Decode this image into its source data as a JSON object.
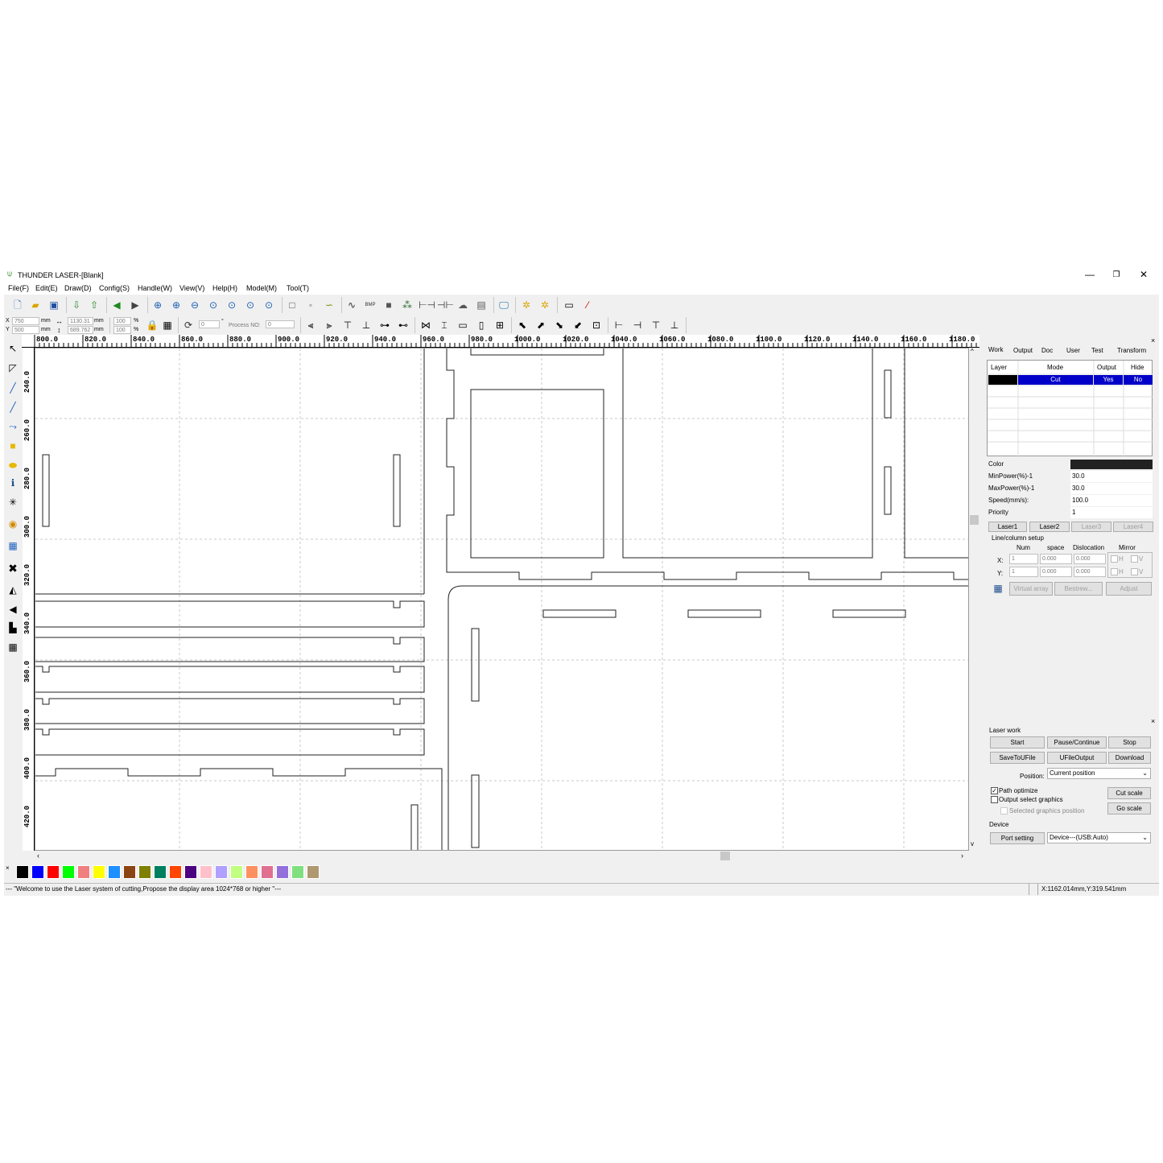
{
  "app": {
    "title": "THUNDER LASER-[Blank]"
  },
  "menu": [
    "File(F)",
    "Edit(E)",
    "Draw(D)",
    "Config(S)",
    "Handle(W)",
    "View(V)",
    "Help(H)",
    "Model(M)",
    "Tool(T)"
  ],
  "geometry": {
    "x_label": "X",
    "x_value": "750",
    "x_unit": "mm",
    "y_label": "Y",
    "y_value": "500",
    "y_unit": "mm",
    "w_value": "1130.31",
    "w_unit": "mm",
    "h_value": "689.762",
    "h_unit": "mm",
    "sx_value": "100",
    "sx_unit": "%",
    "sy_value": "100",
    "sy_unit": "%",
    "angle_value": "0",
    "angle_unit": "°",
    "process_label": "Process NO:",
    "process_value": "0"
  },
  "ruler": {
    "top": [
      "800.0",
      "820.0",
      "840.0",
      "860.0",
      "880.0",
      "900.0",
      "920.0",
      "940.0",
      "960.0",
      "980.0",
      "1000.0",
      "1020.0",
      "1040.0",
      "1060.0",
      "1080.0",
      "1100.0",
      "1120.0",
      "1140.0",
      "1160.0",
      "1180.0"
    ],
    "left": [
      "240.0",
      "260.0",
      "280.0",
      "300.0",
      "320.0",
      "340.0",
      "360.0",
      "380.0",
      "400.0",
      "420.0"
    ]
  },
  "panel": {
    "tabs": [
      "Work",
      "Output",
      "Doc",
      "User",
      "Test",
      "Transform"
    ],
    "layer_headers": [
      "Layer",
      "Mode",
      "Output",
      "Hide"
    ],
    "layer_row": {
      "mode": "Cut",
      "output": "Yes",
      "hide": "No"
    },
    "props": [
      {
        "k": "Color",
        "v": ""
      },
      {
        "k": "MinPower(%)-1",
        "v": "30.0"
      },
      {
        "k": "MaxPower(%)-1",
        "v": "30.0"
      },
      {
        "k": "Speed(mm/s):",
        "v": "100.0"
      },
      {
        "k": "Priority",
        "v": "1"
      }
    ],
    "lasers": [
      "Laser1",
      "Laser2",
      "Laser3",
      "Laser4"
    ],
    "array_title": "Line/column setup",
    "array_headers": [
      "Num",
      "space",
      "Dislocation",
      "Mirror"
    ],
    "array_x": {
      "label": "X:",
      "num": "1",
      "space": "0.000",
      "disl": "0.000"
    },
    "array_y": {
      "label": "Y:",
      "num": "1",
      "space": "0.000",
      "disl": "0.000"
    },
    "mirror_h": "H",
    "mirror_v": "V",
    "array_buttons": [
      "Virtual array",
      "Bestrew...",
      "Adjust"
    ]
  },
  "laserwork": {
    "title": "Laser work",
    "buttons": [
      "Start",
      "Pause/Continue",
      "Stop",
      "SaveToUFile",
      "UFileOutput",
      "Download"
    ],
    "position_label": "Position:",
    "position_value": "Current position",
    "path_optimize": "Path optimize",
    "output_select": "Output select graphics",
    "selected_pos": "Selected graphics position",
    "cut_scale": "Cut scale",
    "go_scale": "Go scale",
    "device_title": "Device",
    "port_setting": "Port setting",
    "device_value": "Device---(USB:Auto)"
  },
  "palette": [
    "#000000",
    "#0000ff",
    "#ff0000",
    "#00ff00",
    "#f08080",
    "#ffff00",
    "#1e90ff",
    "#8b4513",
    "#808000",
    "#008060",
    "#ff4500",
    "#4b0082",
    "#ffc0cb",
    "#b0a0ff",
    "#c0ff80",
    "#ff9060",
    "#e07090",
    "#9370db",
    "#80e080",
    "#b09870"
  ],
  "status": {
    "message": "--- \"Welcome to use the Laser system of cutting,Propose the display area 1024*768 or higher \"---",
    "coords": "X:1162.014mm,Y:319.541mm"
  },
  "colors": {
    "selection": "#0000c8",
    "canvas_bg": "#ffffff",
    "chrome": "#f0f0f0"
  }
}
